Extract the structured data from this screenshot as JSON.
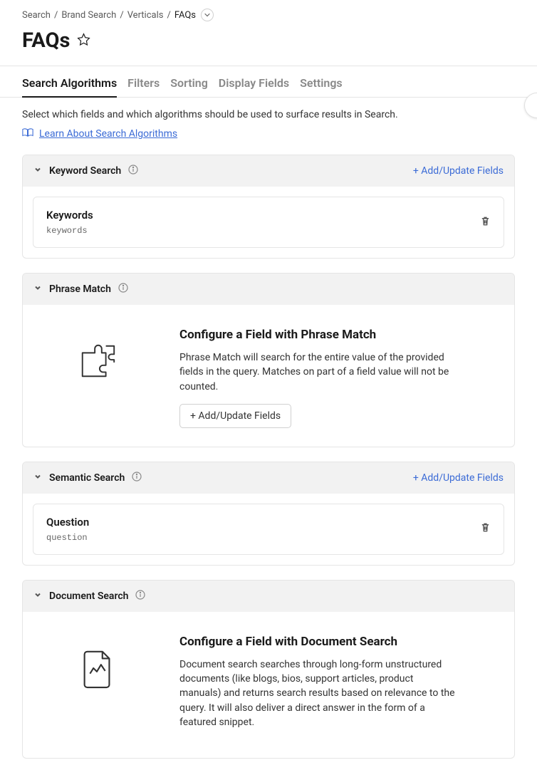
{
  "breadcrumb": {
    "items": [
      "Search",
      "Brand Search",
      "Verticals"
    ],
    "current": "FAQs"
  },
  "page_title": "FAQs",
  "tabs": [
    {
      "label": "Search Algorithms",
      "active": true
    },
    {
      "label": "Filters",
      "active": false
    },
    {
      "label": "Sorting",
      "active": false
    },
    {
      "label": "Display Fields",
      "active": false
    },
    {
      "label": "Settings",
      "active": false
    }
  ],
  "description": "Select which fields and which algorithms should be used to surface results in Search.",
  "learn_link": "Learn About Search Algorithms",
  "sections": {
    "keyword": {
      "title": "Keyword Search",
      "add_label": "+ Add/Update Fields",
      "field": {
        "name": "Keywords",
        "code": "keywords"
      }
    },
    "phrase": {
      "title": "Phrase Match",
      "empty_title": "Configure a Field with Phrase Match",
      "empty_desc": "Phrase Match will search for the entire value of the provided fields in the query. Matches on part of a field value will not be counted.",
      "add_btn": "+ Add/Update Fields"
    },
    "semantic": {
      "title": "Semantic Search",
      "add_label": "+ Add/Update Fields",
      "field": {
        "name": "Question",
        "code": "question"
      }
    },
    "document": {
      "title": "Document Search",
      "empty_title": "Configure a Field with Document Search",
      "empty_desc": "Document search searches through long-form unstructured documents (like blogs, bios, support articles, product manuals) and returns search results based on relevance to the query. It will also deliver a direct answer in the form of a featured snippet."
    }
  }
}
